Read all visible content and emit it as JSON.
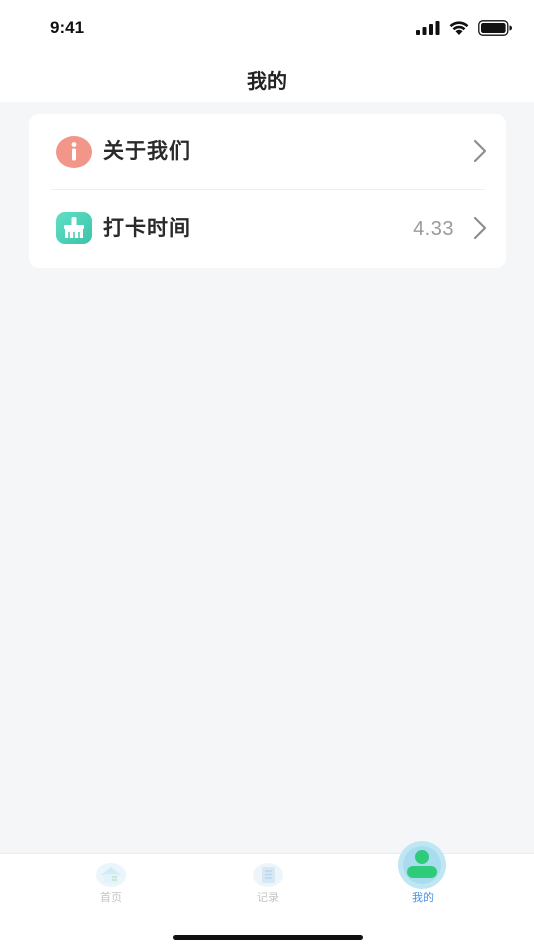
{
  "status_bar": {
    "time": "9:41",
    "icons": [
      "signal-icon",
      "wifi-icon",
      "battery-icon"
    ]
  },
  "header": {
    "title": "我的"
  },
  "menu": {
    "items": [
      {
        "label": "关于我们",
        "value": "",
        "icon": "info-icon",
        "icon_color": "#f2968a"
      },
      {
        "label": "打卡时间",
        "value": "4.33",
        "icon": "brush-icon",
        "icon_color": "#4fd1b8"
      }
    ]
  },
  "tabs": [
    {
      "label": "首页",
      "icon": "home-icon",
      "active": false
    },
    {
      "label": "记录",
      "icon": "list-icon",
      "active": false
    },
    {
      "label": "我的",
      "icon": "user-icon",
      "active": true
    }
  ],
  "colors": {
    "accent": "#4a90e2",
    "active_tab_icon": "#2ecb7a",
    "background": "#f5f6f8"
  }
}
